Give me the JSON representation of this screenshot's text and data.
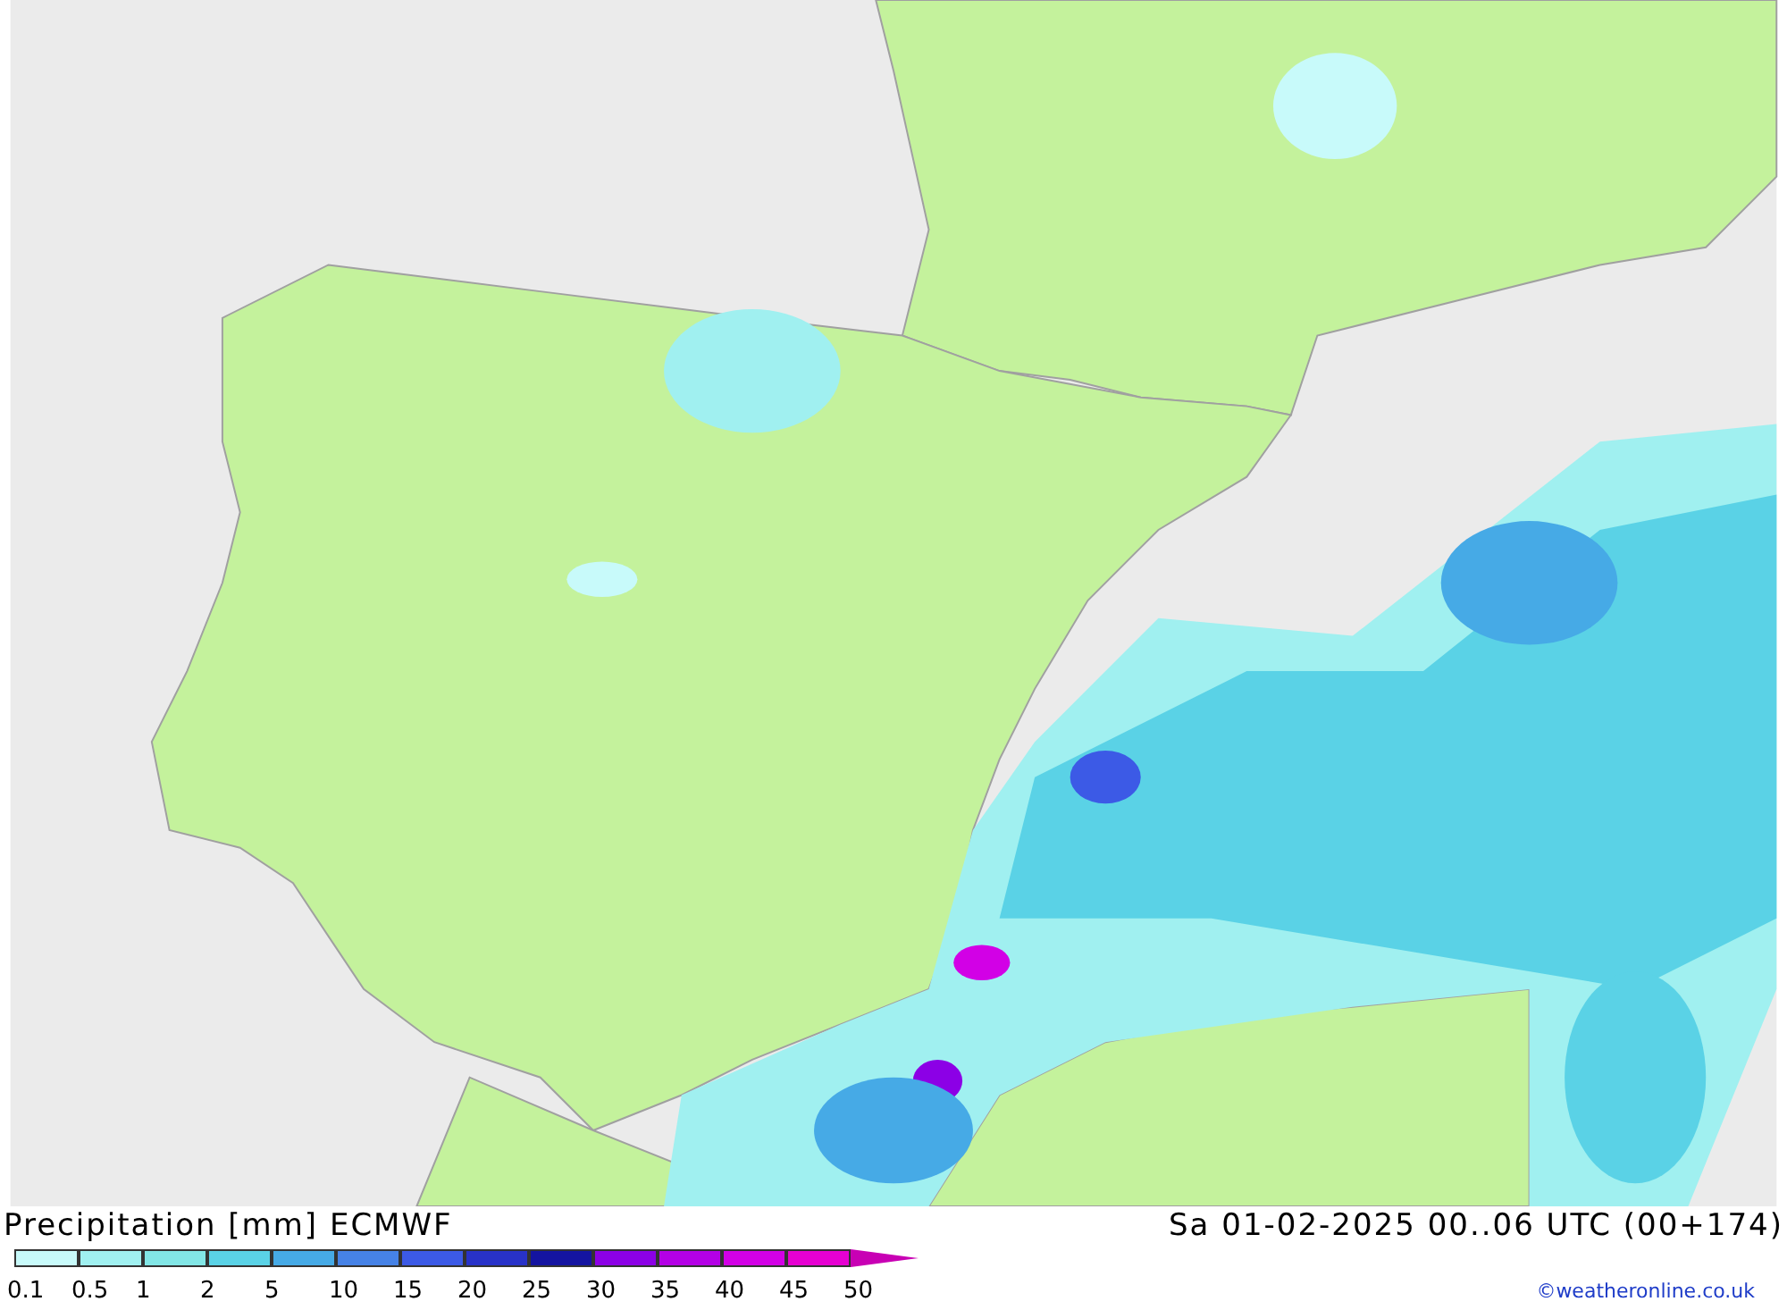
{
  "footer": {
    "title": "Precipitation [mm] ECMWF",
    "datetime": "Sa 01-02-2025 00..06 UTC (00+174)",
    "legend": [
      {
        "label": "0.1",
        "color": "#c8fafa"
      },
      {
        "label": "0.5",
        "color": "#a0f0f0"
      },
      {
        "label": "1",
        "color": "#82e6e6"
      },
      {
        "label": "2",
        "color": "#5ad2e6"
      },
      {
        "label": "5",
        "color": "#46aae6"
      },
      {
        "label": "10",
        "color": "#4682e6"
      },
      {
        "label": "15",
        "color": "#3c5ae6"
      },
      {
        "label": "20",
        "color": "#2832c8"
      },
      {
        "label": "25",
        "color": "#1414a0"
      },
      {
        "label": "30",
        "color": "#8c00e6"
      },
      {
        "label": "35",
        "color": "#b400e6"
      },
      {
        "label": "40",
        "color": "#d200e6"
      },
      {
        "label": "45",
        "color": "#e600d2"
      },
      {
        "label": "50",
        "color": "#c800b4"
      }
    ],
    "copyright": "©weatheronline.co.uk"
  }
}
